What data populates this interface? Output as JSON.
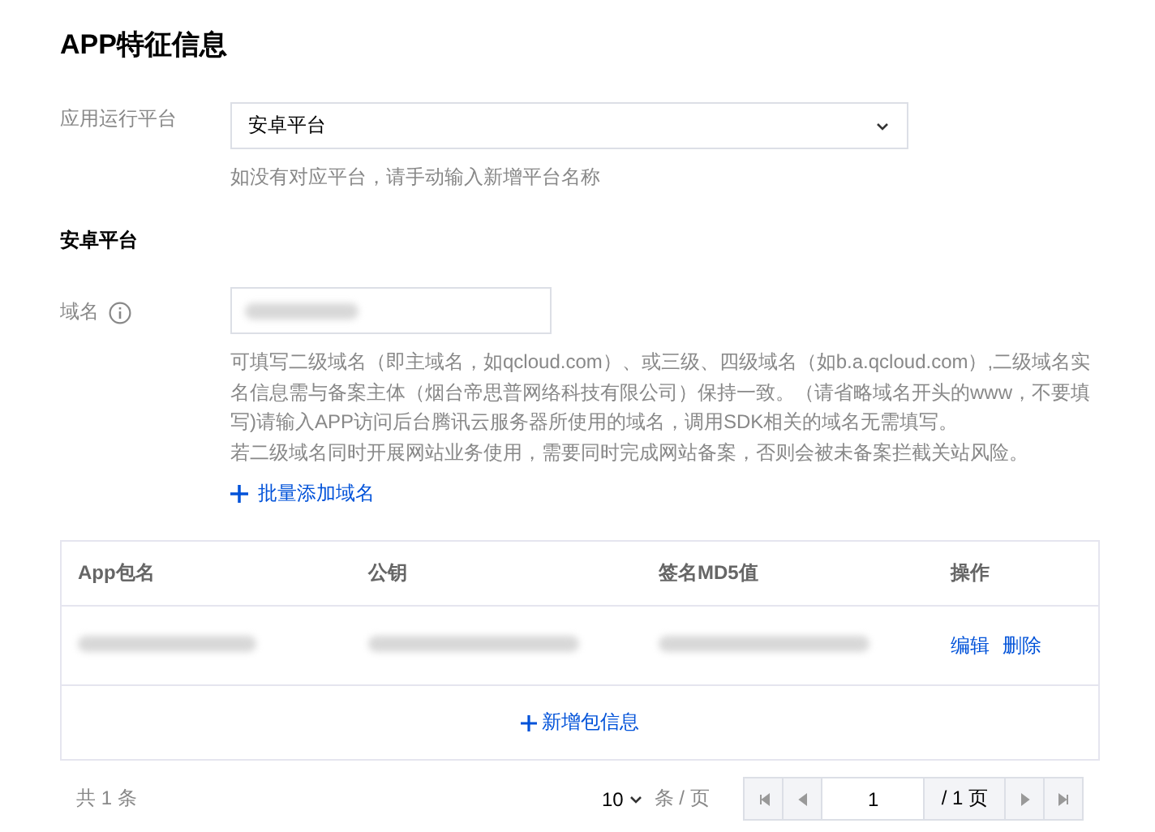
{
  "title": "APP特征信息",
  "platform": {
    "label": "应用运行平台",
    "value": "安卓平台",
    "hint": "如没有对应平台，请手动输入新增平台名称"
  },
  "section_title": "安卓平台",
  "domain": {
    "label": "域名",
    "description": [
      "可填写二级域名（即主域名，如qcloud.com）、或三级、四级域名（如b.a.qcloud.com）,二级域名实名信息需与备案主体（烟台帝思普网络科技有限公司）保持一致。（请省略域名开头的www，不要填写)请输入APP访问后台腾讯云服务器所使用的域名，调用SDK相关的域名无需填写。",
      "若二级域名同时开展网站业务使用，需要同时完成网站备案，否则会被未备案拦截关站风险。"
    ],
    "batch_add": "批量添加域名"
  },
  "table": {
    "columns": [
      "App包名",
      "公钥",
      "签名MD5值",
      "操作"
    ],
    "rows": [
      {
        "actions": [
          "编辑",
          "删除"
        ]
      }
    ],
    "add_label": "新增包信息"
  },
  "pagination": {
    "total": "共 1 条",
    "page_size": "10",
    "per_page": "条 / 页",
    "page": "1",
    "page_total": "/ 1 页"
  }
}
